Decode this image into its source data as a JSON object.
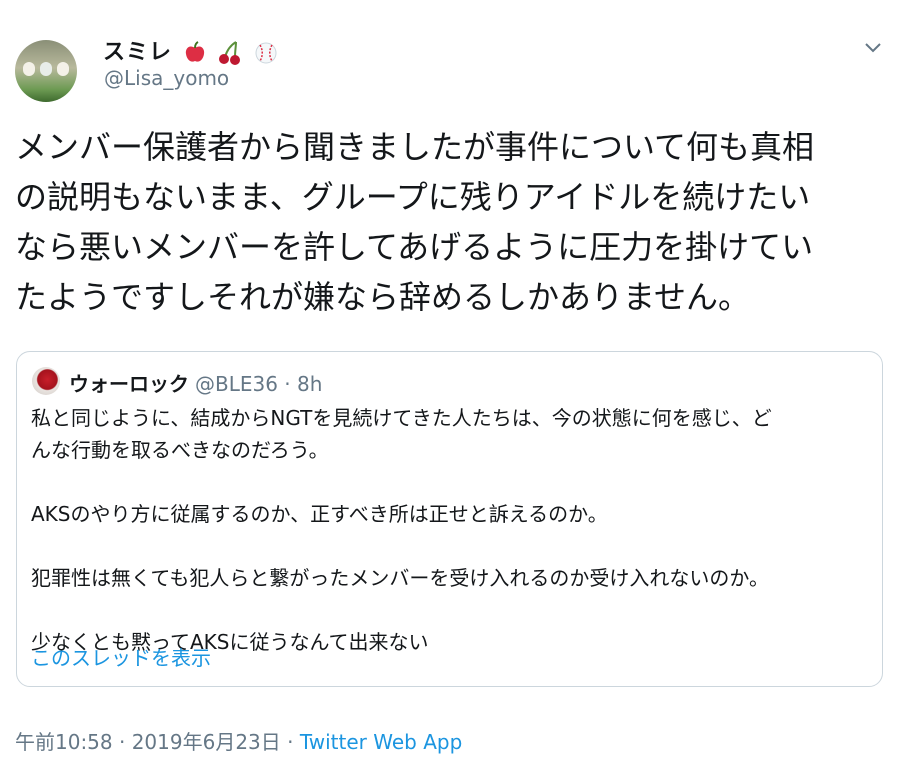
{
  "author": {
    "display_name": "スミレ",
    "emoji": [
      "apple-icon",
      "cherries-icon",
      "baseball-icon"
    ],
    "handle": "@Lisa_yomo"
  },
  "tweet": {
    "text": "メンバー保護者から聞きましたが事件について何も真相\nの説明もないまま、グループに残りアイドルを続けたい\nなら悪いメンバーを許してあげるように圧力を掛けてい\nたようですしそれが嫌なら辞めるしかありません。"
  },
  "quoted": {
    "display_name": "ウォーロック",
    "handle_time": "@BLE36 · 8h",
    "body": "私と同じように、結成からNGTを見続けてきた人たちは、今の状態に何を感じ、ど\nんな行動を取るべきなのだろう。\n\nAKSのやり方に従属するのか、正すべき所は正せと訴えるのか。\n\n犯罪性は無くても犯人らと繋がったメンバーを受け入れるのか受け入れないのか。\n\n少なくとも黙ってAKSに従うなんて出来ない",
    "show_thread": "このスレッドを表示"
  },
  "footer": {
    "timestamp": "午前10:58 · 2019年6月23日 · ",
    "source": "Twitter Web App"
  },
  "colors": {
    "link": "#1b95e0",
    "secondary_text": "#657786",
    "border": "#ccd6dd"
  }
}
